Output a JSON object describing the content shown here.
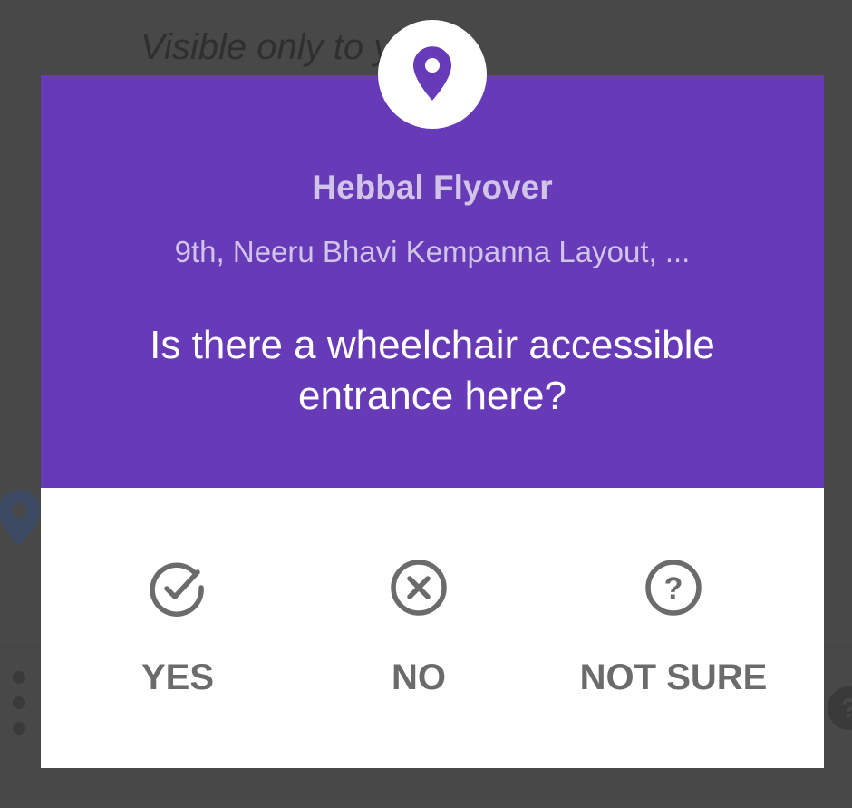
{
  "background": {
    "visibility_text": "Visible only to y"
  },
  "dialog": {
    "title": "Hebbal Flyover",
    "address": "9th, Neeru Bhavi Kempanna Layout, ...",
    "question": "Is there a wheelchair accessible entrance here?",
    "icon": "map-pin-icon",
    "accent_color": "#673ab7"
  },
  "answers": {
    "yes": {
      "label": "YES",
      "icon": "check-circle-icon"
    },
    "no": {
      "label": "NO",
      "icon": "cancel-circle-icon"
    },
    "not_sure": {
      "label": "NOT SURE",
      "icon": "help-circle-icon"
    }
  }
}
